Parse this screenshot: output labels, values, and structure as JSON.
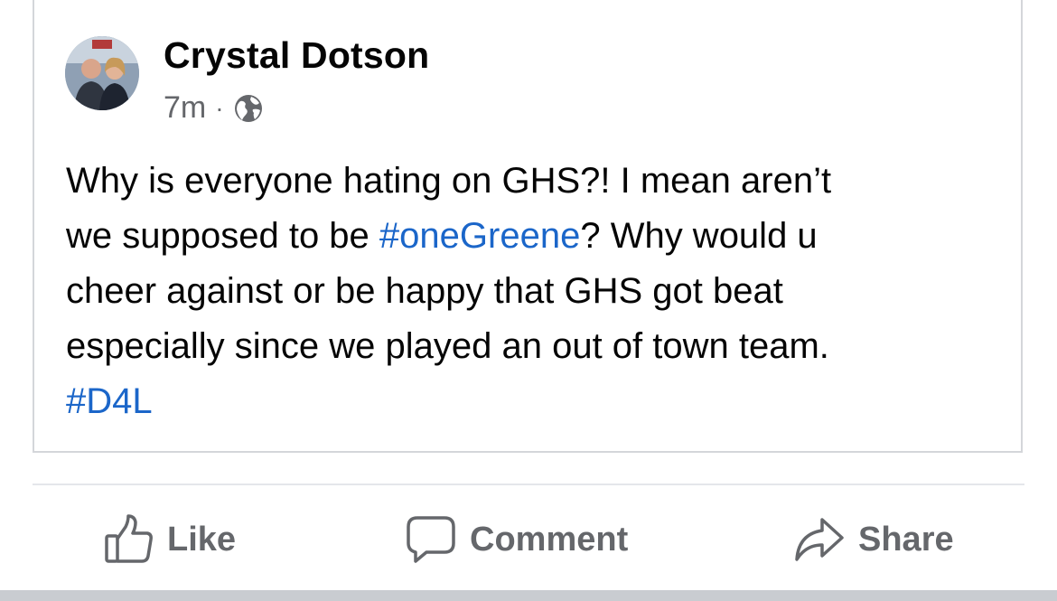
{
  "post": {
    "author": "Crystal Dotson",
    "timestamp": "7m",
    "separator": "·",
    "privacy_icon": "globe-icon",
    "text": {
      "line1": "Why is everyone hating on GHS?!  I mean aren’t",
      "line2_before": "we supposed to be ",
      "hashtag1": "#oneGreene",
      "line2_after": "?  Why would u",
      "line3": "cheer against or be happy that GHS got beat",
      "line4": "especially since we played an out of town team.",
      "hashtag2": "#D4L"
    }
  },
  "actions": {
    "like": {
      "label": "Like",
      "icon": "thumbs-up-icon"
    },
    "comment": {
      "label": "Comment",
      "icon": "speech-bubble-icon"
    },
    "share": {
      "label": "Share",
      "icon": "share-arrow-icon"
    }
  },
  "colors": {
    "hashtag": "#1b66c9",
    "secondary_text": "#65676b",
    "primary_text": "#050505",
    "border": "#d4d6da"
  }
}
